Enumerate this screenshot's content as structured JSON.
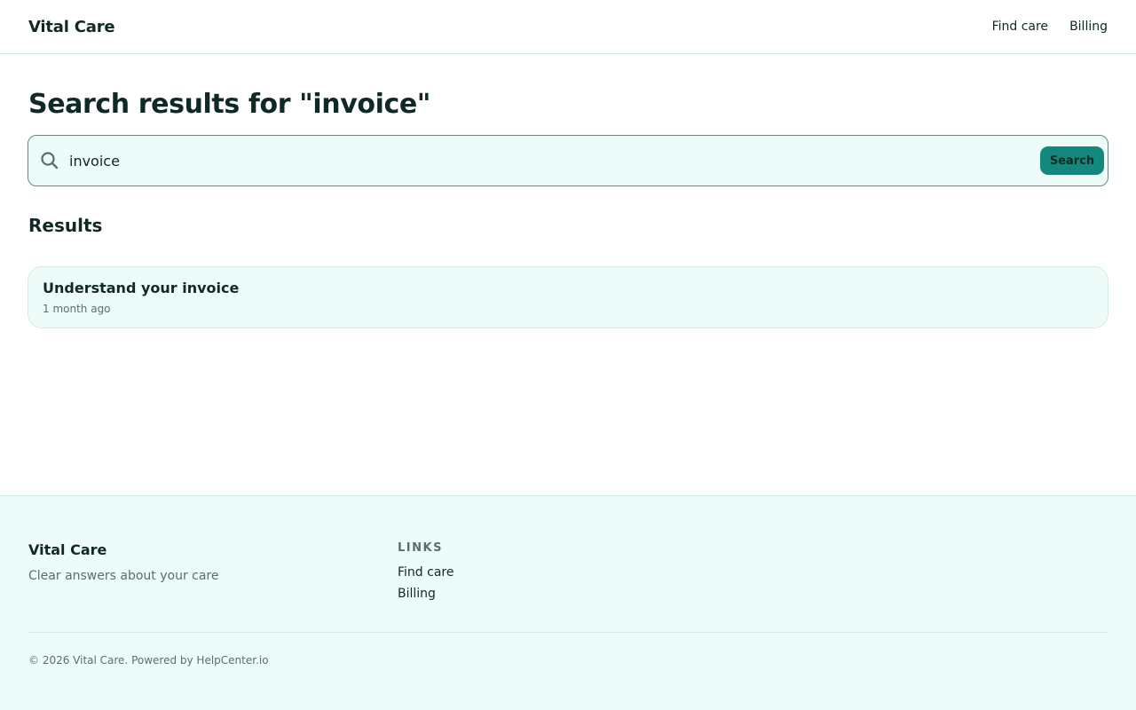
{
  "header": {
    "brand": "Vital Care",
    "nav": [
      {
        "label": "Find care"
      },
      {
        "label": "Billing"
      }
    ]
  },
  "page": {
    "title": "Search results for \"invoice\""
  },
  "search": {
    "value": "invoice",
    "button_label": "Search",
    "icon": "search-icon"
  },
  "results": {
    "heading": "Results",
    "items": [
      {
        "title": "Understand your invoice",
        "meta": "1 month ago"
      }
    ]
  },
  "footer": {
    "brand": "Vital Care",
    "tagline": "Clear answers about your care",
    "links_heading": "LINKS",
    "links": [
      {
        "label": "Find care"
      },
      {
        "label": "Billing"
      }
    ],
    "copyright": "© 2026 Vital Care. Powered by HelpCenter.io"
  },
  "colors": {
    "accent": "#13897d",
    "surface": "#eefcf9",
    "text": "#0f2a26",
    "muted": "#5a6f6b"
  }
}
